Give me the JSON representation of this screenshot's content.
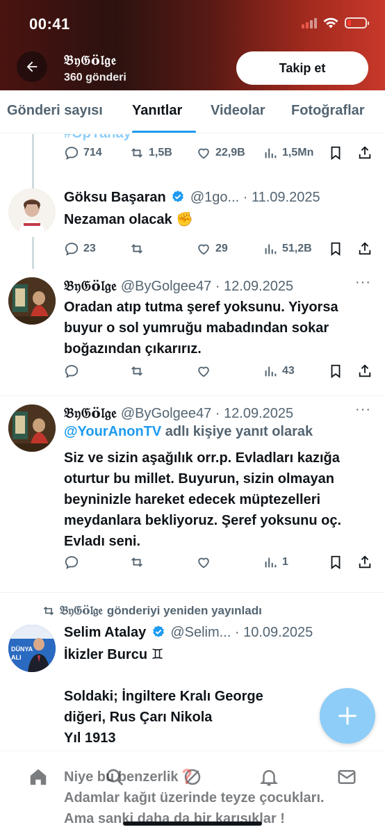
{
  "status": {
    "time": "00:41"
  },
  "header": {
    "profile_name": "𝔅𝔶𝔊ö𝔩𝔤𝔢",
    "post_count": "360 gönderi",
    "follow_label": "Takip et"
  },
  "tabs": [
    {
      "label": "Gönderi sayısı"
    },
    {
      "label": "Yanıtlar",
      "active": true
    },
    {
      "label": "Videolar"
    },
    {
      "label": "Fotoğraflar"
    }
  ],
  "posts": {
    "p0": {
      "cut_text": "#OpYanay",
      "replies": "714",
      "reposts": "1,5B",
      "likes": "22,9B",
      "views": "1,5Mn"
    },
    "p1": {
      "name": "Göksu Başaran",
      "handle": "@1go...",
      "date": "· 11.09.2025",
      "text": "Nezaman olacak ✊",
      "replies": "23",
      "reposts": "",
      "likes": "29",
      "views": "51,2B"
    },
    "p2": {
      "name": "𝔅𝔶𝔊ö𝔩𝔤𝔢",
      "handle": "@ByGolgee47",
      "date": "· 12.09.2025",
      "text": "Oradan atıp tutma şeref yoksunu. Yiyorsa buyur  o sol yumruğu mabadından sokar boğazından çıkarırız.",
      "replies": "",
      "reposts": "",
      "likes": "",
      "views": "43"
    },
    "p3": {
      "name": "𝔅𝔶𝔊ö𝔩𝔤𝔢",
      "handle": "@ByGolgee47",
      "date": "· 12.09.2025",
      "reply_link": "@YourAnonTV",
      "reply_suffix": " adlı kişiye yanıt olarak",
      "text": "Siz ve sizin aşağılık orr.p. Evladları kazığa oturtur bu millet. Buyurun, sizin olmayan beyninizle hareket edecek müptezelleri  meydanlara bekliyoruz. Şeref yoksunu oç. Evladı seni.",
      "views": "1"
    },
    "p4": {
      "repost_by": "𝔅𝔶𝔊ö𝔩𝔤𝔢",
      "repost_suffix": "gönderiyi yeniden yayınladı",
      "name": "Selim Atalay",
      "handle": "@Selim...",
      "date": "· 10.09.2025",
      "line1": "İkizler Burcu ♊",
      "line2": "Soldaki; İngiltere Kralı George",
      "line3": "diğeri, Rus Çarı Nikola",
      "line4": "Yıl 1913"
    }
  },
  "overlay": {
    "line1": "Niye bu benzerlik❓",
    "line2": "Adamlar kağıt üzerinde teyze çocukları.",
    "line3": "Ama sanki daha da bir karışıklar !"
  },
  "colors": {
    "accent": "#1d9bf0",
    "header_red": "#c7392a",
    "secondary_text": "#536471"
  }
}
